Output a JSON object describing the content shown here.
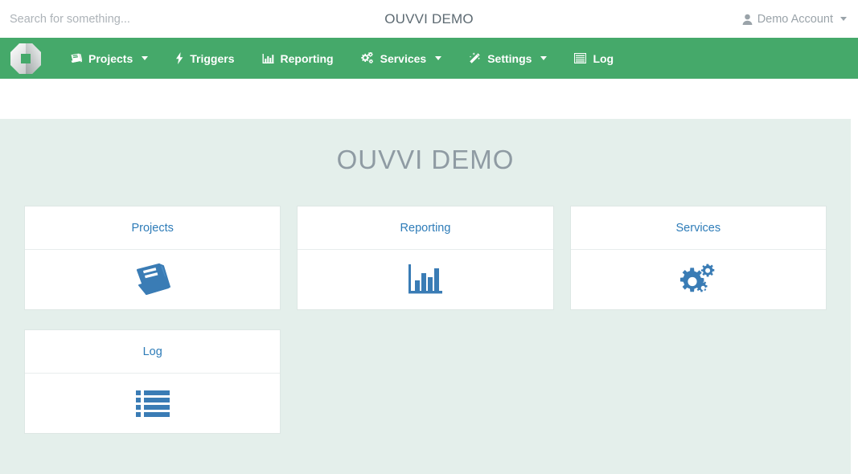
{
  "theme": {
    "nav_green": "#45a96a",
    "content_mint": "#e4efeb",
    "link_blue": "#2e7cb8",
    "title_grey": "#8f9ba3",
    "icon_blue": "#3a7cb5"
  },
  "topbar": {
    "search_placeholder": "Search for something...",
    "search_value": "",
    "title": "OUVVI DEMO",
    "account_label": "Demo Account",
    "account_icon": "user-icon",
    "account_caret": "caret-down-icon"
  },
  "navbar": {
    "logo_name": "ouvvi-logo",
    "items": [
      {
        "label": "Projects",
        "icon": "book-icon",
        "has_caret": true
      },
      {
        "label": "Triggers",
        "icon": "bolt-icon",
        "has_caret": false
      },
      {
        "label": "Reporting",
        "icon": "bar-chart-icon",
        "has_caret": false
      },
      {
        "label": "Services",
        "icon": "gears-icon",
        "has_caret": true
      },
      {
        "label": "Settings",
        "icon": "magic-wand-icon",
        "has_caret": true
      },
      {
        "label": "Log",
        "icon": "list-icon",
        "has_caret": false
      }
    ]
  },
  "main": {
    "heading": "OUVVI DEMO",
    "cards": [
      {
        "title": "Projects",
        "icon": "book-icon"
      },
      {
        "title": "Reporting",
        "icon": "bar-chart-icon"
      },
      {
        "title": "Services",
        "icon": "gears-icon"
      },
      {
        "title": "Log",
        "icon": "list-icon"
      }
    ]
  }
}
